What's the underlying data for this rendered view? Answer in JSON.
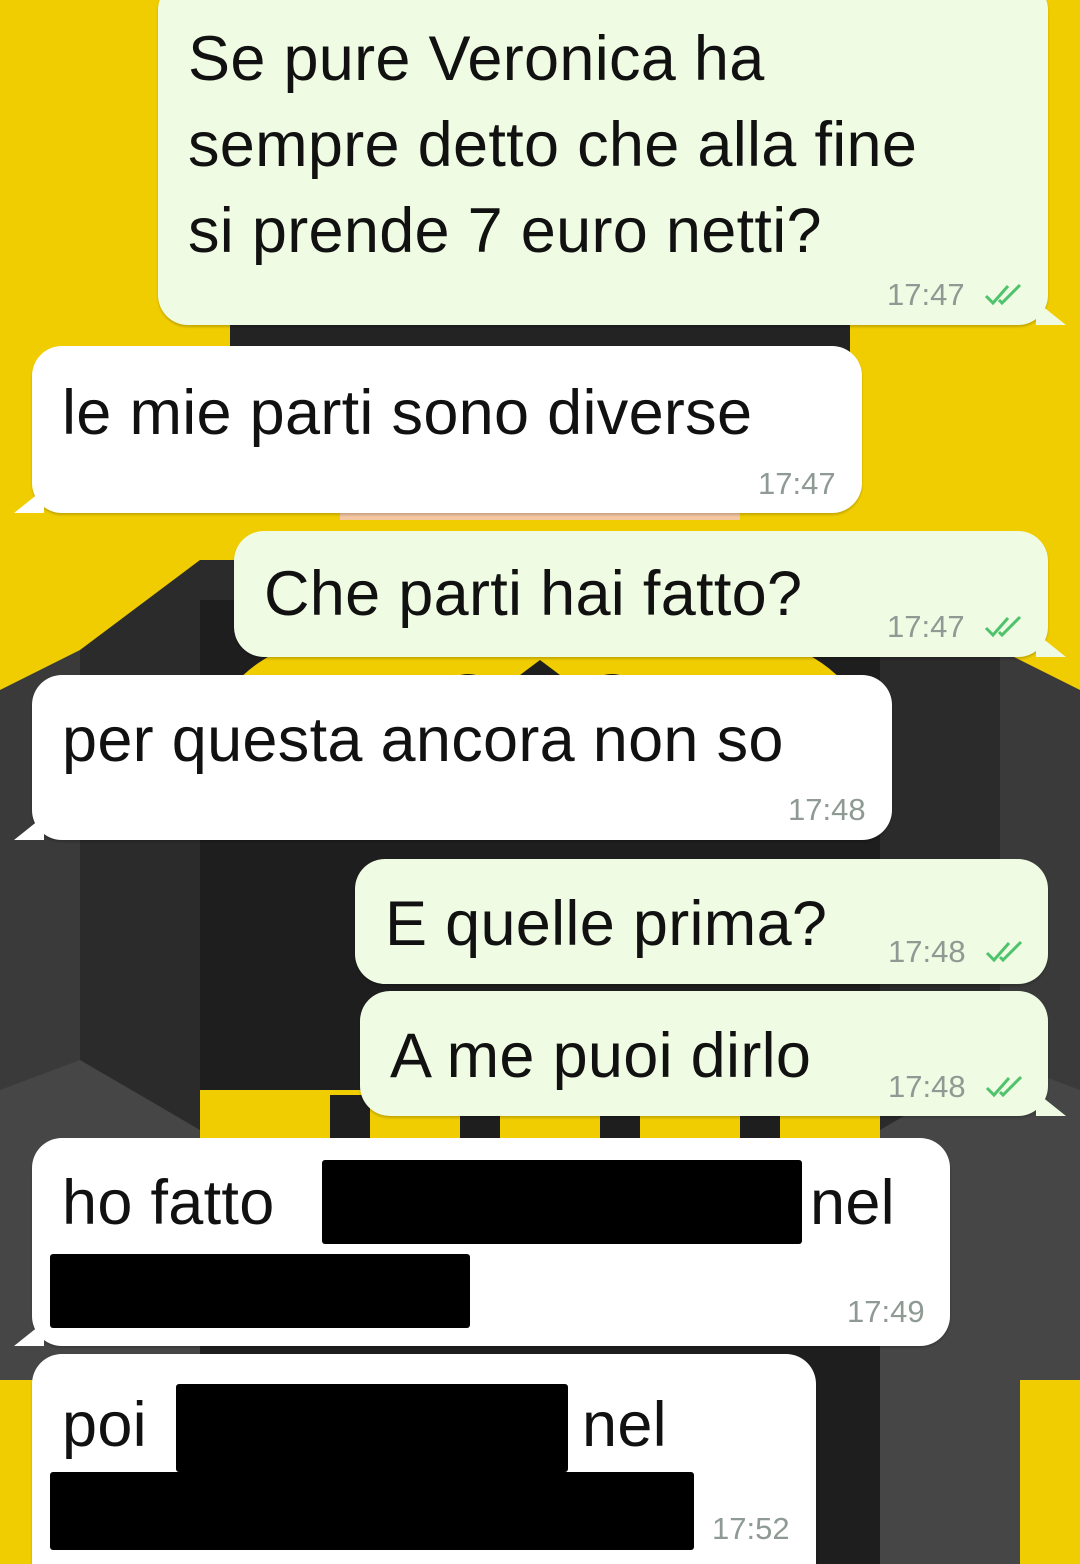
{
  "colors": {
    "wallpaper_yellow": "#f0cd00",
    "outgoing_bubble": "#effbe2",
    "incoming_bubble": "#ffffff",
    "read_ticks": "#4fc36b",
    "timestamp": "#8e9a93",
    "redaction": "#000000"
  },
  "messages": [
    {
      "direction": "outgoing",
      "lines": [
        "Se pure Veronica ha",
        "sempre detto che alla fine",
        "si prende 7 euro netti?"
      ],
      "time": "17:47",
      "status_icon": "double-check-icon"
    },
    {
      "direction": "incoming",
      "lines": [
        "le mie parti sono diverse"
      ],
      "time": "17:47"
    },
    {
      "direction": "outgoing",
      "lines": [
        "Che parti hai fatto?"
      ],
      "time": "17:47",
      "status_icon": "double-check-icon"
    },
    {
      "direction": "incoming",
      "lines": [
        "per questa ancora non so"
      ],
      "time": "17:48"
    },
    {
      "direction": "outgoing",
      "lines": [
        "E quelle prima?"
      ],
      "time": "17:48",
      "status_icon": "double-check-icon"
    },
    {
      "direction": "outgoing",
      "lines": [
        "A me puoi dirlo"
      ],
      "time": "17:48",
      "status_icon": "double-check-icon"
    },
    {
      "direction": "incoming",
      "parts": [
        "ho fatto",
        "nel"
      ],
      "time": "17:49",
      "redacted": true
    },
    {
      "direction": "incoming",
      "parts": [
        "poi",
        "nel"
      ],
      "time": "17:52",
      "redacted": true
    }
  ]
}
